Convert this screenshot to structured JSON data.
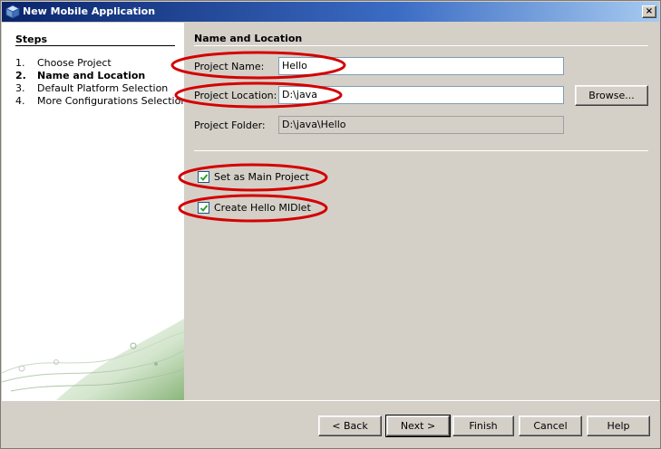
{
  "window": {
    "title": "New Mobile Application",
    "close_glyph": "×"
  },
  "steps": {
    "title": "Steps",
    "items": [
      {
        "num": "1.",
        "label": "Choose Project"
      },
      {
        "num": "2.",
        "label": "Name and Location"
      },
      {
        "num": "3.",
        "label": "Default Platform Selection"
      },
      {
        "num": "4.",
        "label": "More Configurations Selection"
      }
    ],
    "current_index": 1
  },
  "main": {
    "section_title": "Name and Location",
    "project_name_label": "Project Name:",
    "project_name_value": "Hello",
    "project_location_label": "Project Location:",
    "project_location_value": "D:\\java",
    "browse_label": "Browse...",
    "project_folder_label": "Project Folder:",
    "project_folder_value": "D:\\java\\Hello",
    "set_main_label": "Set as Main Project",
    "set_main_checked": true,
    "create_midlet_label": "Create Hello MIDlet",
    "create_midlet_checked": true
  },
  "buttons": {
    "back": "< Back",
    "next": "Next >",
    "finish": "Finish",
    "cancel": "Cancel",
    "help": "Help"
  },
  "colors": {
    "annotation": "#d40000",
    "titlebar_start": "#0a246a",
    "panel_background": "#d4d0c8"
  }
}
